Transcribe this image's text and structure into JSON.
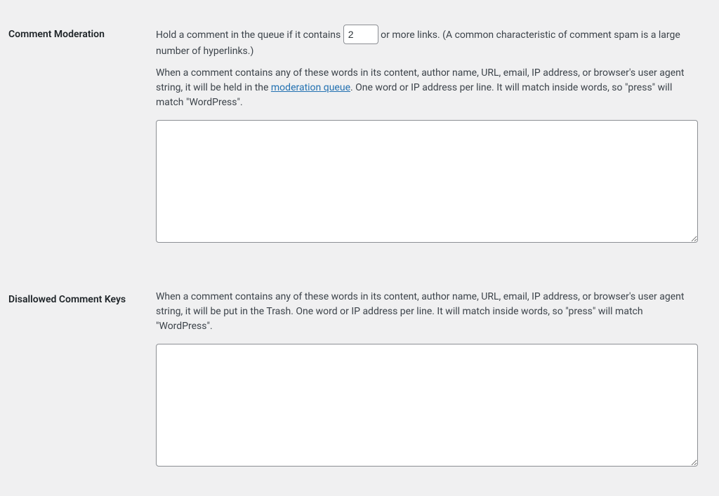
{
  "moderation": {
    "heading": "Comment Moderation",
    "hold_text_before": "Hold a comment in the queue if it contains ",
    "hold_links_value": "2",
    "hold_text_after": " or more links. (A common characteristic of comment spam is a large number of hyperlinks.)",
    "desc_part1": "When a comment contains any of these words in its content, author name, URL, email, IP address, or browser's user agent string, it will be held in the ",
    "queue_link_text": "moderation queue",
    "desc_part2": ". One word or IP address per line. It will match inside words, so \"press\" will match \"WordPress\".",
    "textarea_value": ""
  },
  "disallowed": {
    "heading": "Disallowed Comment Keys",
    "desc": "When a comment contains any of these words in its content, author name, URL, email, IP address, or browser's user agent string, it will be put in the Trash. One word or IP address per line. It will match inside words, so \"press\" will match \"WordPress\".",
    "textarea_value": ""
  }
}
